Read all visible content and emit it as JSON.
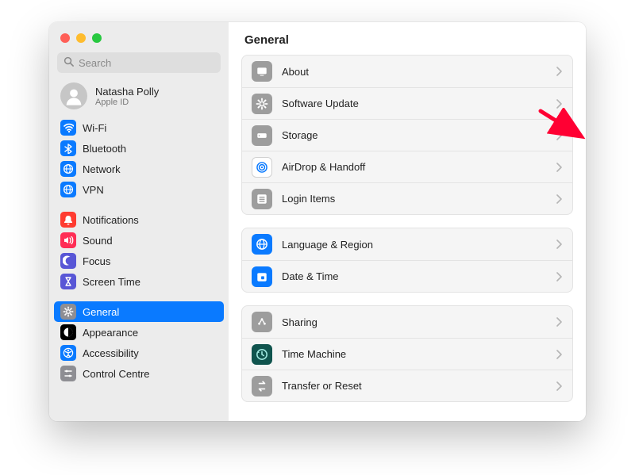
{
  "header": {
    "title": "General"
  },
  "search": {
    "placeholder": "Search"
  },
  "account": {
    "name": "Natasha Polly",
    "sub": "Apple ID"
  },
  "sidebar": {
    "groups": [
      {
        "items": [
          {
            "id": "wifi",
            "label": "Wi-Fi",
            "icon": "wifi-icon",
            "bg": "#0a7aff"
          },
          {
            "id": "bluetooth",
            "label": "Bluetooth",
            "icon": "bluetooth-icon",
            "bg": "#0a7aff"
          },
          {
            "id": "network",
            "label": "Network",
            "icon": "network-icon",
            "bg": "#0a7aff"
          },
          {
            "id": "vpn",
            "label": "VPN",
            "icon": "vpn-icon",
            "bg": "#0a7aff"
          }
        ]
      },
      {
        "items": [
          {
            "id": "notifications",
            "label": "Notifications",
            "icon": "bell-icon",
            "bg": "#ff3b30"
          },
          {
            "id": "sound",
            "label": "Sound",
            "icon": "sound-icon",
            "bg": "#ff2d55"
          },
          {
            "id": "focus",
            "label": "Focus",
            "icon": "focus-icon",
            "bg": "#5856d6"
          },
          {
            "id": "screen-time",
            "label": "Screen Time",
            "icon": "hourglass-icon",
            "bg": "#5856d6"
          }
        ]
      },
      {
        "items": [
          {
            "id": "general",
            "label": "General",
            "icon": "gear-icon",
            "bg": "#8e8e93",
            "selected": true
          },
          {
            "id": "appearance",
            "label": "Appearance",
            "icon": "appearance-icon",
            "bg": "#000000"
          },
          {
            "id": "accessibility",
            "label": "Accessibility",
            "icon": "accessibility-icon",
            "bg": "#0a7aff"
          },
          {
            "id": "control-centre",
            "label": "Control Centre",
            "icon": "control-centre-icon",
            "bg": "#8e8e93"
          }
        ]
      }
    ]
  },
  "main": {
    "groups": [
      {
        "rows": [
          {
            "id": "about",
            "label": "About",
            "icon": "about-icon",
            "bg": "#9d9d9d"
          },
          {
            "id": "software-update",
            "label": "Software Update",
            "icon": "gear-icon",
            "bg": "#9d9d9d"
          },
          {
            "id": "storage",
            "label": "Storage",
            "icon": "storage-icon",
            "bg": "#9d9d9d"
          },
          {
            "id": "airdrop-handoff",
            "label": "AirDrop & Handoff",
            "icon": "airdrop-icon",
            "bg": "#ffffff",
            "border": "#d0d0d0"
          },
          {
            "id": "login-items",
            "label": "Login Items",
            "icon": "login-items-icon",
            "bg": "#9d9d9d"
          }
        ]
      },
      {
        "rows": [
          {
            "id": "language-region",
            "label": "Language & Region",
            "icon": "globe-icon",
            "bg": "#0a7aff"
          },
          {
            "id": "date-time",
            "label": "Date & Time",
            "icon": "calendar-icon",
            "bg": "#0a7aff"
          }
        ]
      },
      {
        "rows": [
          {
            "id": "sharing",
            "label": "Sharing",
            "icon": "sharing-icon",
            "bg": "#9d9d9d"
          },
          {
            "id": "time-machine",
            "label": "Time Machine",
            "icon": "time-machine-icon",
            "bg": "#10544e"
          },
          {
            "id": "transfer-reset",
            "label": "Transfer or Reset",
            "icon": "transfer-icon",
            "bg": "#9d9d9d"
          }
        ]
      }
    ]
  },
  "annotation": {
    "arrow_color": "#ff0033"
  }
}
